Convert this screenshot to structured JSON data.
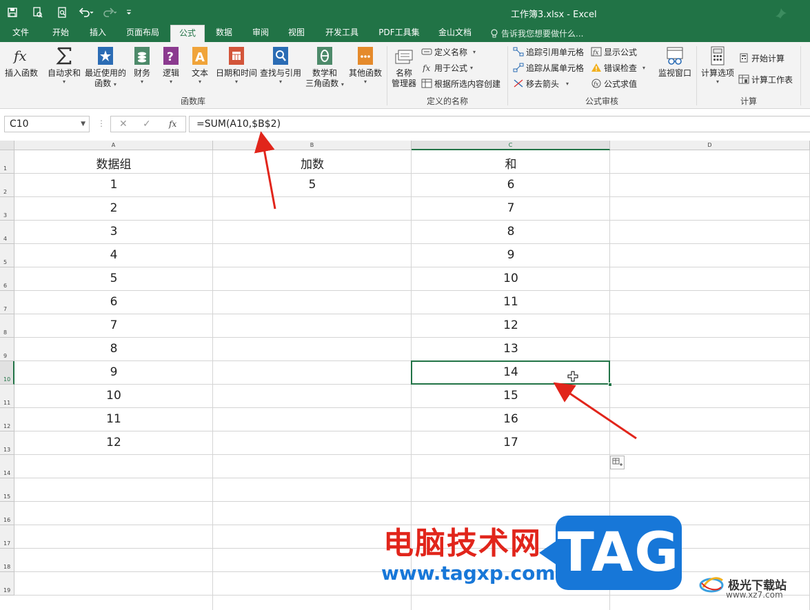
{
  "window": {
    "title": "工作簿3.xlsx - Excel"
  },
  "tabs": [
    {
      "label": "文件"
    },
    {
      "label": "开始"
    },
    {
      "label": "插入"
    },
    {
      "label": "页面布局"
    },
    {
      "label": "公式",
      "active": true
    },
    {
      "label": "数据"
    },
    {
      "label": "审阅"
    },
    {
      "label": "视图"
    },
    {
      "label": "开发工具"
    },
    {
      "label": "PDF工具集"
    },
    {
      "label": "金山文档"
    }
  ],
  "tell_me": "告诉我您想要做什么...",
  "ribbon": {
    "function_library": {
      "label": "函数库",
      "insert_function": "插入函数",
      "autosum": "自动求和",
      "recent_line1": "最近使用的",
      "recent_line2": "函数",
      "financial": "财务",
      "logical": "逻辑",
      "text": "文本",
      "datetime": "日期和时间",
      "lookup": "查找与引用",
      "math_line1": "数学和",
      "math_line2": "三角函数",
      "more": "其他函数"
    },
    "defined_names": {
      "label": "定义的名称",
      "name_manager_line1": "名称",
      "name_manager_line2": "管理器",
      "define_name": "定义名称",
      "use_in_formula": "用于公式",
      "create_from_selection": "根据所选内容创建"
    },
    "formula_auditing": {
      "label": "公式审核",
      "trace_precedents": "追踪引用单元格",
      "trace_dependents": "追踪从属单元格",
      "remove_arrows": "移去箭头",
      "show_formulas": "显示公式",
      "error_checking": "错误检查",
      "evaluate_formula": "公式求值",
      "watch_window": "监视窗口"
    },
    "calculation": {
      "label": "计算",
      "calc_options": "计算选项",
      "calc_now": "开始计算",
      "calc_sheet": "计算工作表"
    }
  },
  "formula_bar": {
    "name_box": "C10",
    "formula": "=SUM(A10,$B$2)",
    "fx": "fx"
  },
  "sheet": {
    "columns": [
      "A",
      "B",
      "C",
      "D"
    ],
    "rows": [
      "1",
      "2",
      "3",
      "4",
      "5",
      "6",
      "7",
      "8",
      "9",
      "10",
      "11",
      "12",
      "13",
      "14",
      "15",
      "16",
      "17",
      "18",
      "19"
    ],
    "active_cell": "C10",
    "cells": {
      "A1": "数据组",
      "B1": "加数",
      "C1": "和",
      "A2": "1",
      "B2": "5",
      "C2": "6",
      "A3": "2",
      "C3": "7",
      "A4": "3",
      "C4": "8",
      "A5": "4",
      "C5": "9",
      "A6": "5",
      "C6": "10",
      "A7": "6",
      "C7": "11",
      "A8": "7",
      "C8": "12",
      "A9": "8",
      "C9": "13",
      "A10": "9",
      "C10": "14",
      "A11": "10",
      "C11": "15",
      "A12": "11",
      "C12": "16",
      "A13": "12",
      "C13": "17"
    }
  },
  "watermark": {
    "cn": "电脑技术网",
    "url": "www.tagxp.com",
    "tag": "TAG",
    "site_cn": "极光下载站",
    "site_url": "www.xz7.com"
  },
  "colors": {
    "excel_green": "#217346",
    "annotation_red": "#e1251b",
    "watermark_blue": "#1777d8"
  }
}
